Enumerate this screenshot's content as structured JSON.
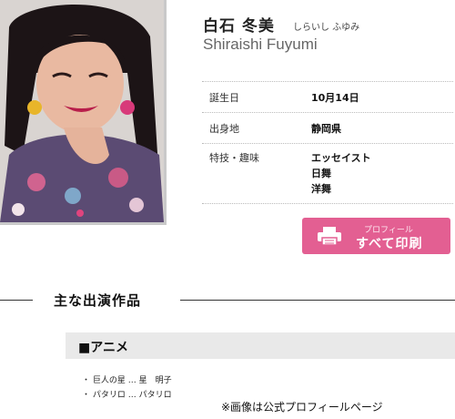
{
  "profile_page": {
    "photo": {
      "alt": "白石冬美"
    },
    "name": {
      "japanese": "白石 冬美",
      "kana": "しらいし ふゆみ",
      "romaji": "Shiraishi Fuyumi"
    },
    "details": [
      {
        "label": "誕生日",
        "values": [
          "10月14日"
        ]
      },
      {
        "label": "出身地",
        "values": [
          "静岡県"
        ]
      },
      {
        "label": "特技・趣味",
        "values": [
          "エッセイスト",
          "日舞",
          "洋舞"
        ]
      }
    ],
    "print_button": {
      "small_label": "プロフィール",
      "label": "すべて印刷",
      "icon": "printer-icon"
    },
    "section": {
      "title": "主な出演作品"
    },
    "anime": {
      "heading": "■アニメ",
      "works": [
        "・ 巨人の星 … 星　明子",
        "・ パタリロ … パタリロ"
      ]
    },
    "caption": "※画像は公式プロフィールページ"
  },
  "colors": {
    "print_button": "#e35f92",
    "section_bar": "#e9e9e9"
  }
}
